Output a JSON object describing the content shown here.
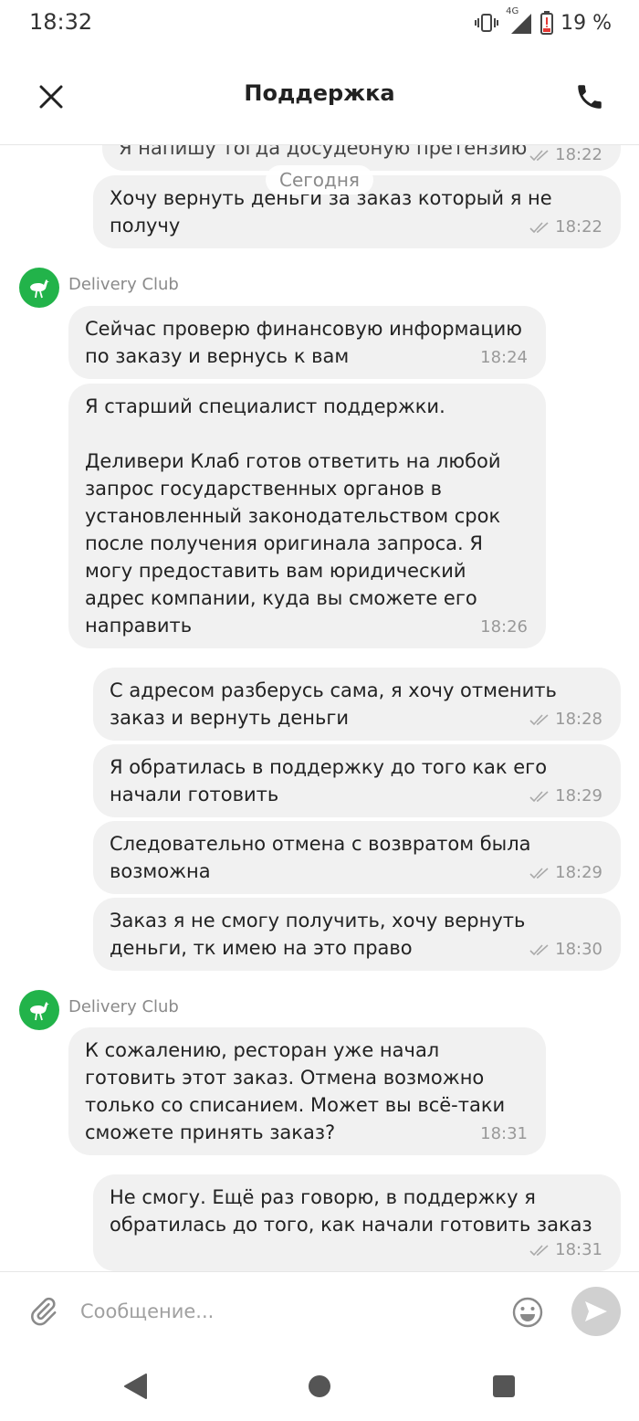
{
  "status_bar": {
    "time": "18:32",
    "network": "4G",
    "battery": "19 %"
  },
  "header": {
    "title": "Поддержка",
    "close_icon": "close-icon",
    "phone_icon": "phone-icon"
  },
  "chat": {
    "date_divider": "Сегодня",
    "sender_name": "Delivery Club",
    "messages": [
      {
        "id": "m0",
        "type": "own",
        "text": "Я напишу тогда досудебную претензию",
        "time": "18:22"
      },
      {
        "id": "m1",
        "type": "own",
        "text": "Хочу вернуть деньги за заказ который я не получу",
        "time": "18:22"
      },
      {
        "id": "m2",
        "type": "incoming",
        "text": "Сейчас проверю финансовую информацию по заказу и вернусь к вам",
        "time": "18:24"
      },
      {
        "id": "m3",
        "type": "incoming",
        "text": "Я старший специалист поддержки.\n\nДеливери Клаб готов ответить на любой запрос государственных органов в установленный законодательством срок после получения оригинала запроса. Я могу предоставить вам юридический адрес компании, куда вы сможете его направить",
        "time": "18:26"
      },
      {
        "id": "m4",
        "type": "own",
        "text": "С адресом разберусь сама, я хочу отменить заказ и вернуть деньги",
        "time": "18:28"
      },
      {
        "id": "m5",
        "type": "own",
        "text": "Я обратилась в поддержку до того как его начали готовить",
        "time": "18:29"
      },
      {
        "id": "m6",
        "type": "own",
        "text": "Следовательно отмена с возвратом была возможна",
        "time": "18:29"
      },
      {
        "id": "m7",
        "type": "own",
        "text": "Заказ я не смогу получить, хочу вернуть деньги, тк имею на это право",
        "time": "18:30"
      },
      {
        "id": "m8",
        "type": "incoming",
        "text": "К сожалению, ресторан уже начал готовить этот заказ. Отмена возможно только со списанием. Может вы всё-таки сможете принять заказ?",
        "time": "18:31"
      },
      {
        "id": "m9",
        "type": "own",
        "text": "Не смогу. Ещё раз говорю, в поддержку я обратилась до того, как начали готовить заказ",
        "time": "18:31"
      }
    ]
  },
  "input": {
    "placeholder": "Сообщение...",
    "value": ""
  },
  "colors": {
    "accent_green": "#22b34a",
    "bubble_bg": "#f1f1f1",
    "meta_gray": "#999999",
    "send_button_inactive": "#d0d0d0"
  }
}
